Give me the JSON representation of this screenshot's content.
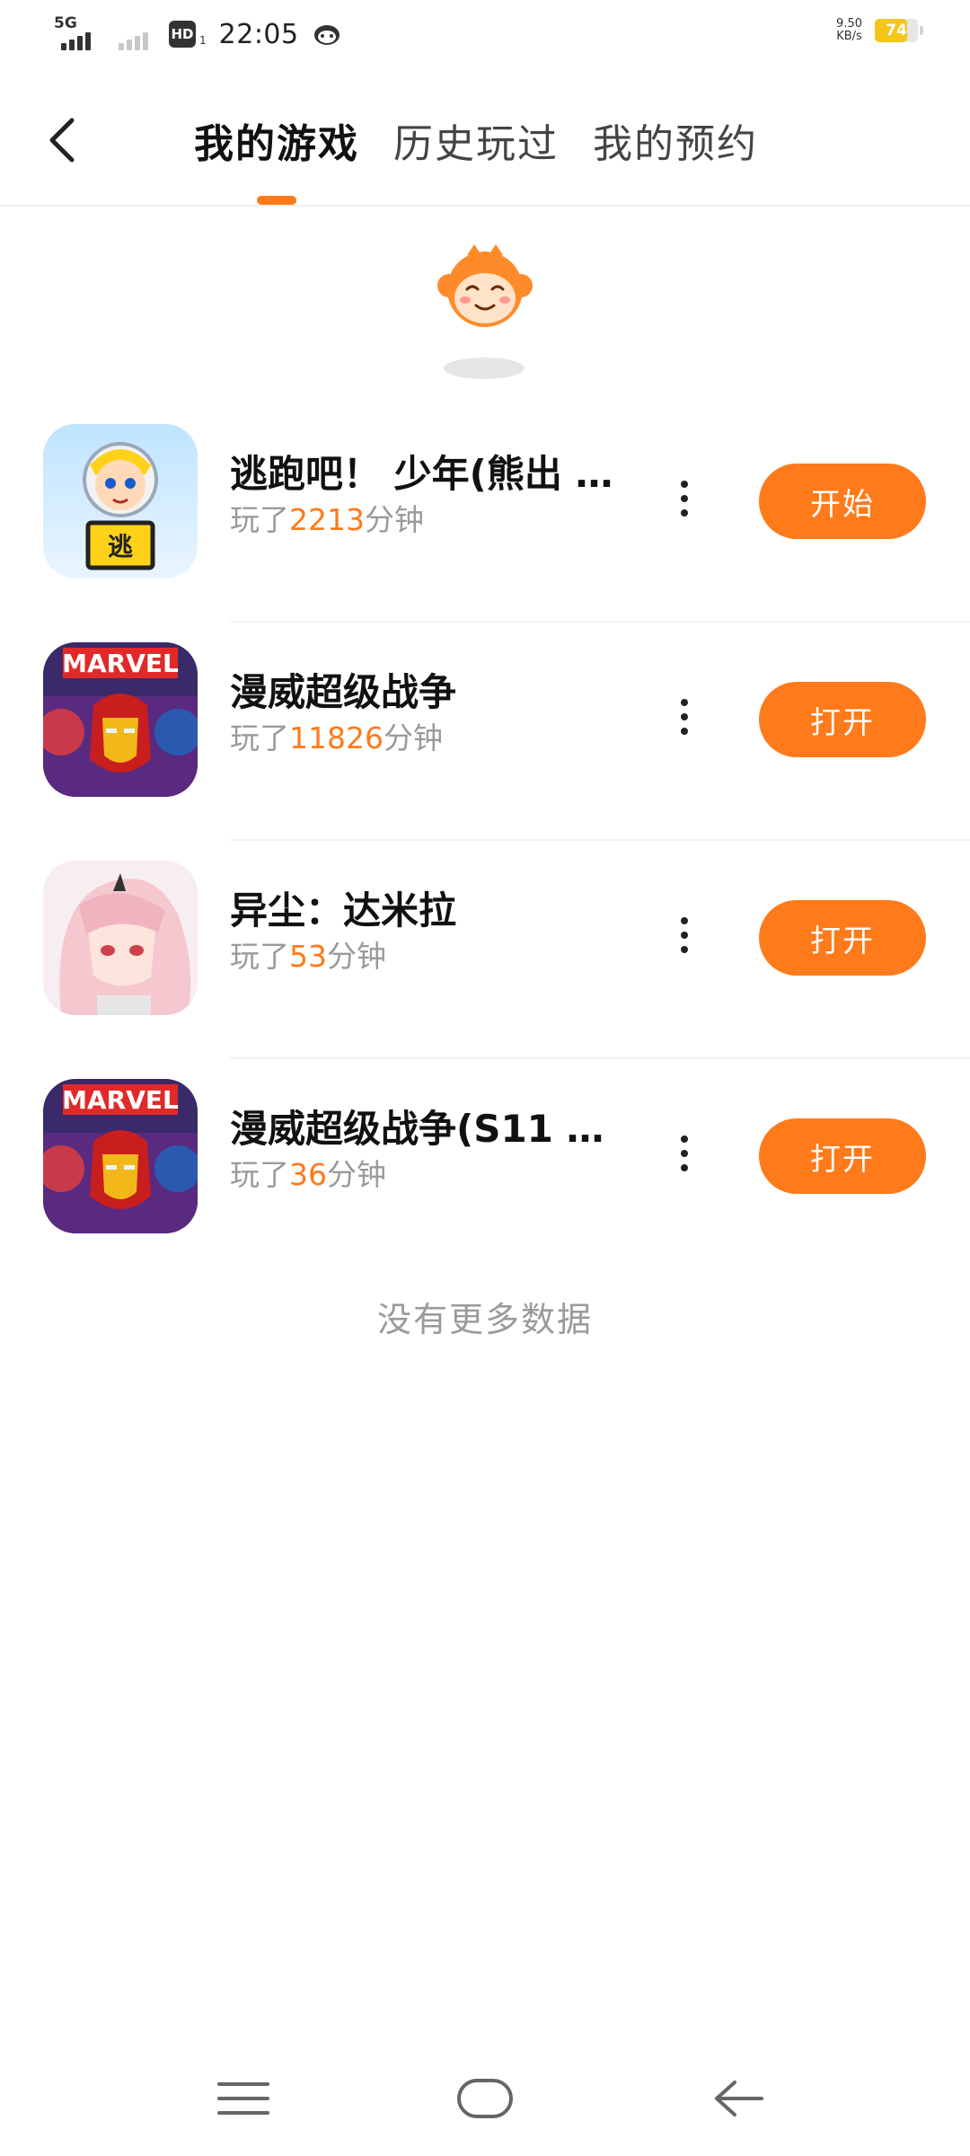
{
  "status_bar": {
    "network_label": "5G",
    "hd_label": "HD",
    "hd_sub": "1",
    "time": "22:05",
    "net_speed_value": "9.50",
    "net_speed_unit": "KB/s",
    "battery_level": "74",
    "battery_fraction": 0.74
  },
  "header": {
    "tabs": [
      {
        "label": "我的游戏",
        "active": true
      },
      {
        "label": "历史玩过",
        "active": false
      },
      {
        "label": "我的预约",
        "active": false
      }
    ]
  },
  "games": [
    {
      "title": "逃跑吧！ 少年(熊出 …",
      "meta_prefix": "玩了",
      "minutes": "2213",
      "meta_suffix": "分钟",
      "button": "开始",
      "icon": "game-icon-escape"
    },
    {
      "title": "漫威超级战争",
      "meta_prefix": "玩了",
      "minutes": "11826",
      "meta_suffix": "分钟",
      "button": "打开",
      "icon": "game-icon-marvel",
      "icon_text": "MARVEL"
    },
    {
      "title": "异尘：达米拉",
      "meta_prefix": "玩了",
      "minutes": "53",
      "meta_suffix": "分钟",
      "button": "打开",
      "icon": "game-icon-anime-girl"
    },
    {
      "title": "漫威超级战争(S11 …",
      "meta_prefix": "玩了",
      "minutes": "36",
      "meta_suffix": "分钟",
      "button": "打开",
      "icon": "game-icon-marvel",
      "icon_text": "MARVEL"
    }
  ],
  "footer": {
    "no_more": "没有更多数据"
  },
  "colors": {
    "accent": "#ff7a1a",
    "battery": "#f5c518",
    "muted_text": "#9a9a9a"
  }
}
